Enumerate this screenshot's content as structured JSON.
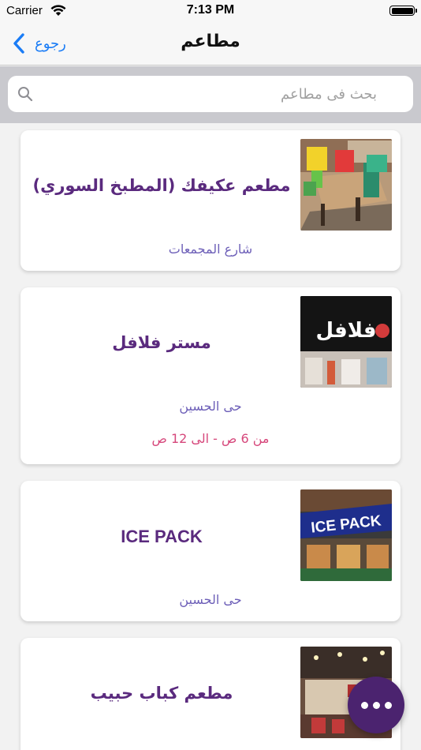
{
  "status_bar": {
    "carrier": "Carrier",
    "time": "7:13 PM"
  },
  "nav": {
    "back_label": "رجوع",
    "title": "مطاعم"
  },
  "search": {
    "placeholder": "بحث فى مطاعم",
    "value": ""
  },
  "restaurants": [
    {
      "name": "مطعم عكيفك (المطبخ السوري)",
      "address": "شارع المجمعات",
      "hours": ""
    },
    {
      "name": "مستر فلافل",
      "address": "حى الحسين",
      "hours": "من 6 ص - الى 12 ص",
      "sign_text": "فلافل"
    },
    {
      "name": "ICE PACK",
      "address": "حى الحسين",
      "hours": "",
      "sign_text": "ICE PACK"
    },
    {
      "name": "مطعم كباب حبيب",
      "address": "",
      "hours": ""
    }
  ],
  "fab": {
    "icon": "more-horizontal-icon"
  },
  "colors": {
    "accent_blue": "#1a7cf6",
    "restaurant_name": "#5a2a7e",
    "address": "#6d5fb8",
    "hours": "#d6477b",
    "fab": "#4b236f"
  }
}
